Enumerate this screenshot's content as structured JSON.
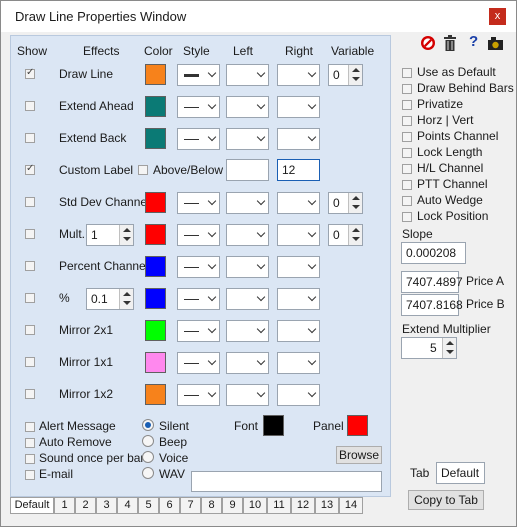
{
  "window": {
    "title": "Draw Line Properties Window",
    "close_label": "x"
  },
  "headers": {
    "show": "Show",
    "effects": "Effects",
    "color": "Color",
    "style": "Style",
    "left": "Left",
    "right": "Right",
    "variable": "Variable"
  },
  "rows": [
    {
      "label": "Draw Line",
      "checked": true,
      "color": "#f7821b",
      "variable": "0"
    },
    {
      "label": "Extend Ahead",
      "checked": false,
      "color": "#0b7a75"
    },
    {
      "label": "Extend Back",
      "checked": false,
      "color": "#0b7a75"
    },
    {
      "label": "Custom Label",
      "checked": true,
      "above_below_label": "Above/Below",
      "right_value": "12"
    },
    {
      "label": "Std Dev Channel",
      "checked": false,
      "color": "#ff0000",
      "variable": "0"
    },
    {
      "label": "Mult.",
      "checked": false,
      "mult_value": "1",
      "color": "#ff0000",
      "variable": "0"
    },
    {
      "label": "Percent Channel",
      "checked": false,
      "color": "#0000ff"
    },
    {
      "label": "%",
      "checked": false,
      "pct_value": "0.1",
      "color": "#0000ff"
    },
    {
      "label": "Mirror 2x1",
      "checked": false,
      "color": "#00ff00"
    },
    {
      "label": "Mirror 1x1",
      "checked": false,
      "color": "#ff88ee"
    },
    {
      "label": "Mirror 1x2",
      "checked": false,
      "color": "#f7821b"
    }
  ],
  "alerts": {
    "alert_message": "Alert Message",
    "auto_remove": "Auto Remove",
    "sound_once": "Sound once per bar",
    "email": "E-mail",
    "silent": "Silent",
    "beep": "Beep",
    "voice": "Voice",
    "wav": "WAV",
    "font_label": "Font",
    "font_color": "#000000",
    "panel_label": "Panel",
    "panel_color": "#ff0000",
    "browse_label": "Browse",
    "selected_sound": "Silent"
  },
  "right": {
    "options": [
      "Use as Default",
      "Draw Behind Bars",
      "Privatize",
      "Horz | Vert",
      "Points Channel",
      "Lock Length",
      "H/L Channel",
      "PTT Channel",
      "Auto Wedge",
      "Lock Position"
    ],
    "slope_label": "Slope",
    "slope_value": "0.000208",
    "price_a_value": "7407.4897",
    "price_a_label": "Price A",
    "price_b_value": "7407.8168",
    "price_b_label": "Price B",
    "extend_multiplier_label": "Extend Multiplier",
    "extend_multiplier_value": "5",
    "tab_label": "Tab",
    "tab_value": "Default",
    "copy_to_tab_label": "Copy to Tab"
  },
  "tabs": [
    "Default",
    "1",
    "2",
    "3",
    "4",
    "5",
    "6",
    "7",
    "8",
    "9",
    "10",
    "11",
    "12",
    "13",
    "14"
  ],
  "active_tab": "Default",
  "icons": [
    "no-entry-icon",
    "trash-icon",
    "help-icon",
    "camera-icon"
  ]
}
